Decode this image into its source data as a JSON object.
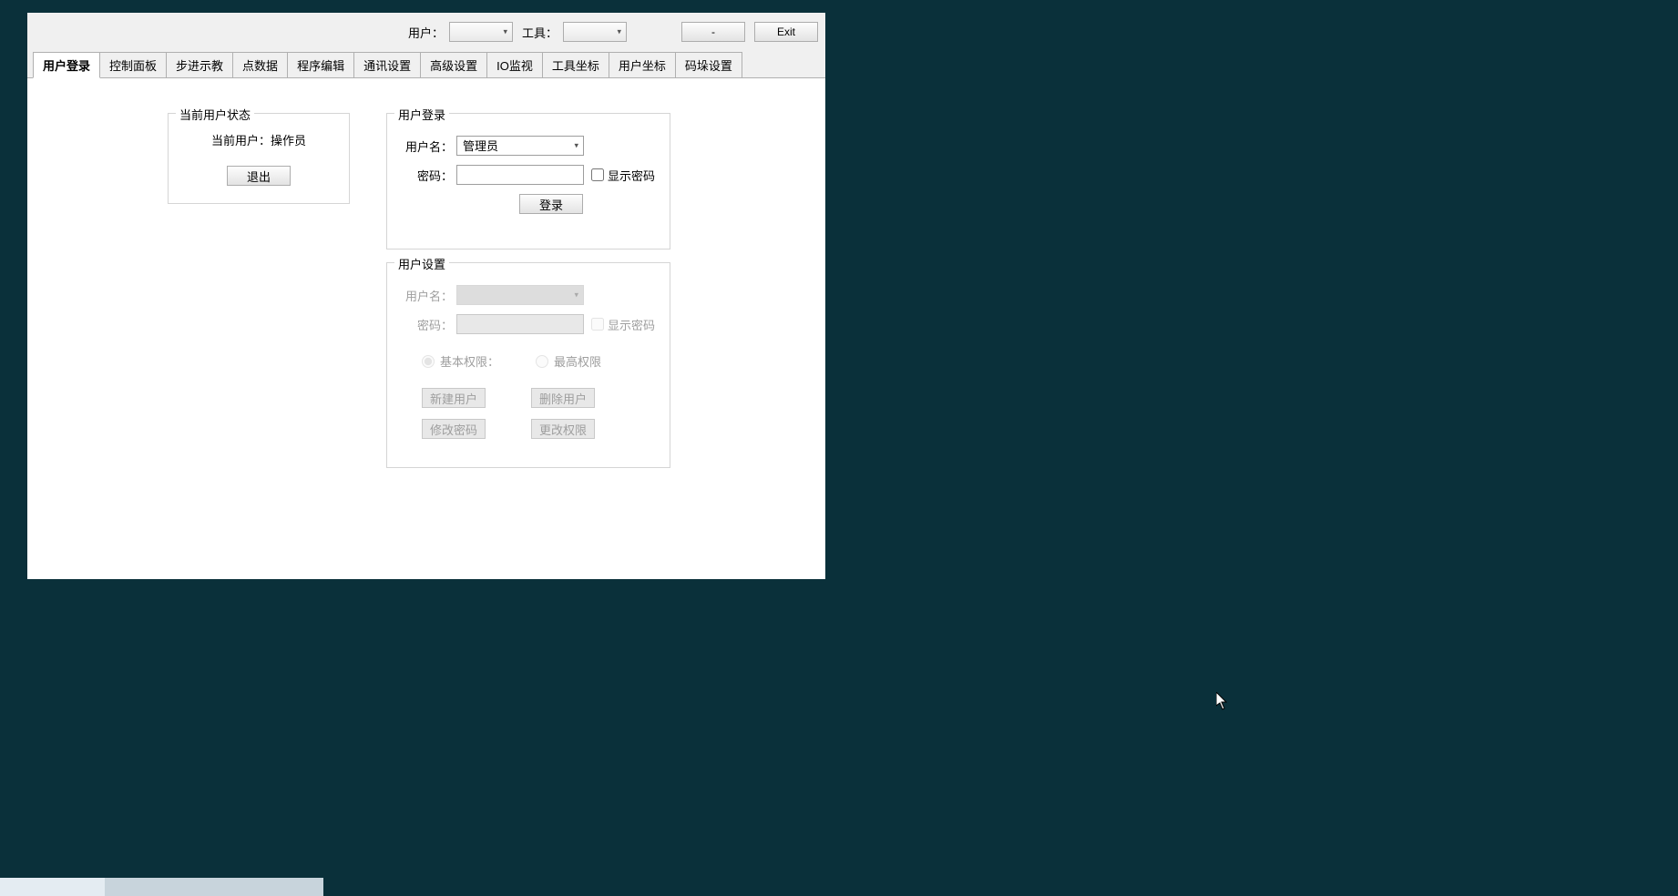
{
  "header": {
    "user_label": "用户：",
    "tool_label": "工具：",
    "minimize_label": "-",
    "exit_label": "Exit"
  },
  "tabs": [
    "用户登录",
    "控制面板",
    "步进示教",
    "点数据",
    "程序编辑",
    "通讯设置",
    "高级设置",
    "IO监视",
    "工具坐标",
    "用户坐标",
    "码垛设置"
  ],
  "current_user_group": {
    "title": "当前用户状态",
    "current_label": "当前用户：操作员",
    "logout_label": "退出"
  },
  "login_group": {
    "title": "用户登录",
    "username_label": "用户名：",
    "username_value": "管理员",
    "password_label": "密码：",
    "show_password_label": "显示密码",
    "login_button": "登录"
  },
  "settings_group": {
    "title": "用户设置",
    "username_label": "用户名：",
    "password_label": "密码：",
    "show_password_label": "显示密码",
    "radio_basic": "基本权限：",
    "radio_max": "最高权限",
    "btn_new": "新建用户",
    "btn_delete": "删除用户",
    "btn_modify_pw": "修改密码",
    "btn_change_perm": "更改权限"
  }
}
